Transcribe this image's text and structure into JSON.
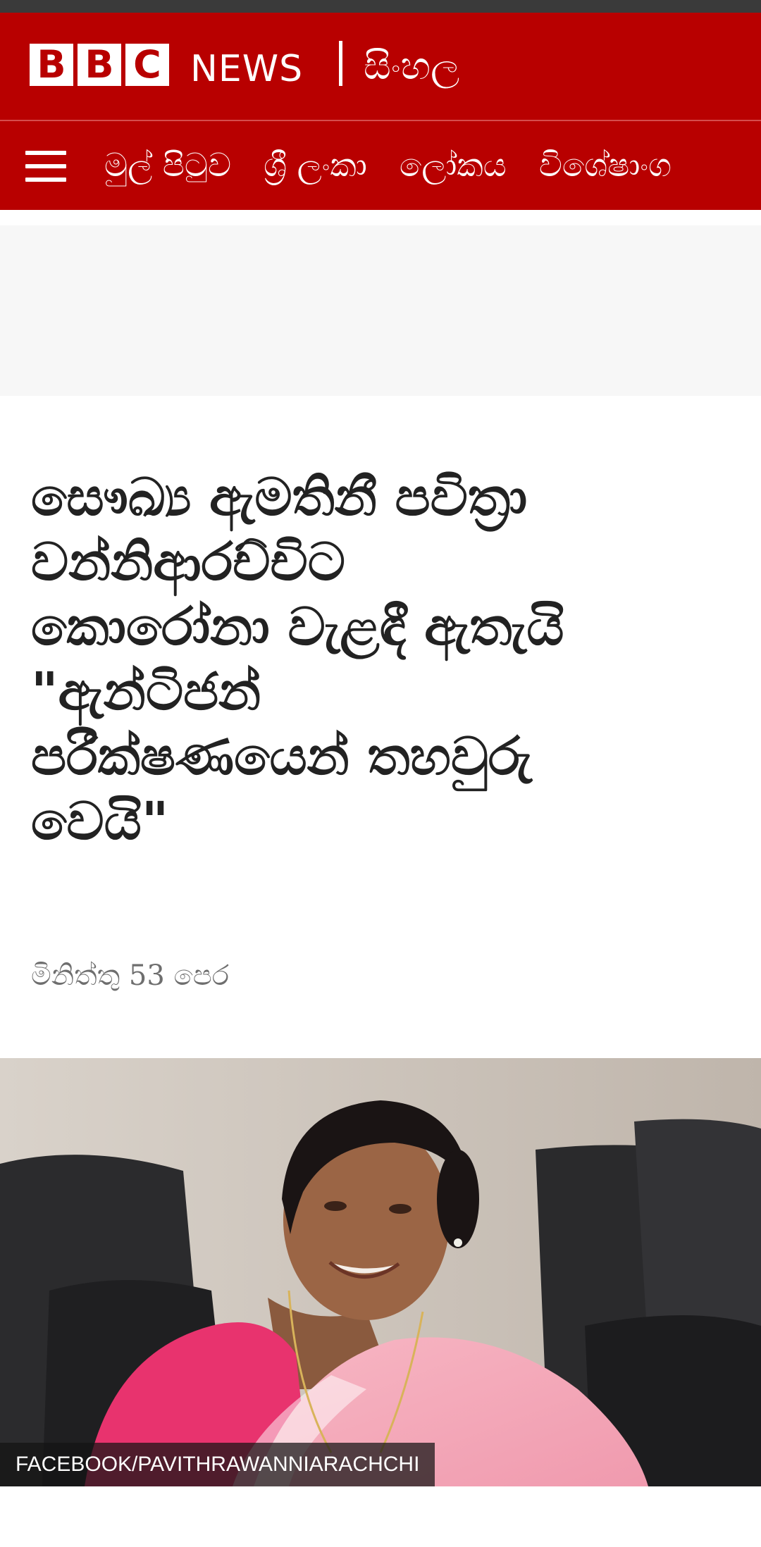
{
  "header": {
    "bbc_letters": [
      "B",
      "B",
      "C"
    ],
    "news_label": "NEWS",
    "language_label": "සිංහල",
    "brand_color": "#b80000"
  },
  "nav": {
    "menu_icon": "hamburger-menu-icon",
    "items": [
      {
        "label": "මුල් පිටුව"
      },
      {
        "label": "ශ්‍රී ලංකා"
      },
      {
        "label": "ලෝකය"
      },
      {
        "label": "විශේෂාංග"
      }
    ]
  },
  "article": {
    "headline_lines": [
      "සෞඛ්‍ය ඇමතිනී පවිත්‍රා",
      "වන්නිආරච්චිට",
      "කොරෝනා වැළඳී ඇතැයි",
      "\"ඇන්ටිජන්",
      "පරීක්ෂණයෙන් තහවුරු",
      "වෙයි\""
    ],
    "timestamp": "මිනිත්තු 53 පෙර",
    "image_credit": "FACEBOOK/PAVITHRAWANNIARACHCHI"
  }
}
